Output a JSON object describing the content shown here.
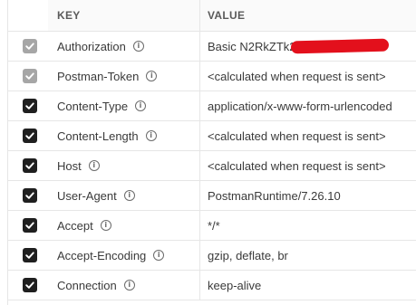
{
  "headers_table": {
    "columns": {
      "key": "KEY",
      "value": "VALUE"
    },
    "rows": [
      {
        "checked": true,
        "disabled": true,
        "key": "Authorization",
        "value": "Basic N2RkZTk2",
        "redacted": true
      },
      {
        "checked": true,
        "disabled": true,
        "key": "Postman-Token",
        "value": "<calculated when request is sent>"
      },
      {
        "checked": true,
        "disabled": false,
        "key": "Content-Type",
        "value": "application/x-www-form-urlencoded"
      },
      {
        "checked": true,
        "disabled": false,
        "key": "Content-Length",
        "value": "<calculated when request is sent>"
      },
      {
        "checked": true,
        "disabled": false,
        "key": "Host",
        "value": "<calculated when request is sent>"
      },
      {
        "checked": true,
        "disabled": false,
        "key": "User-Agent",
        "value": "PostmanRuntime/7.26.10"
      },
      {
        "checked": true,
        "disabled": false,
        "key": "Accept",
        "value": "*/*"
      },
      {
        "checked": true,
        "disabled": false,
        "key": "Accept-Encoding",
        "value": "gzip, deflate, br"
      },
      {
        "checked": true,
        "disabled": false,
        "key": "Connection",
        "value": "keep-alive"
      }
    ]
  },
  "icons": {
    "info": "info-icon",
    "checkbox": "checkmark-icon"
  },
  "colors": {
    "checkbox_checked": "#1f1f1f",
    "checkbox_disabled": "#a6a6a6",
    "redaction": "#e3101c"
  }
}
